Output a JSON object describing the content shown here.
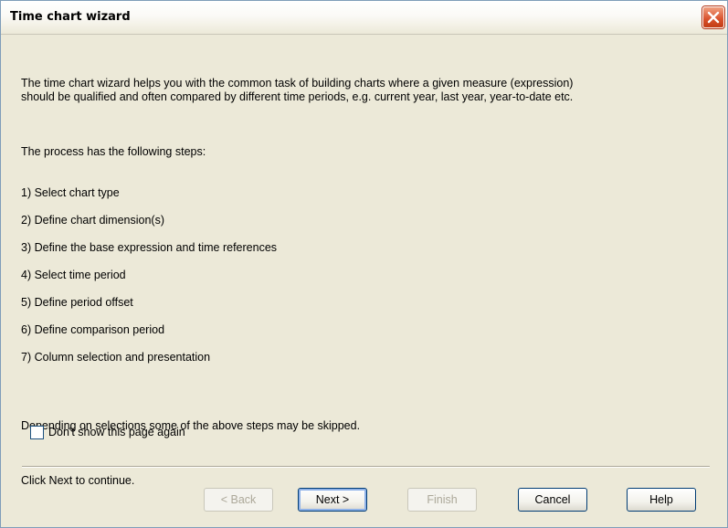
{
  "window": {
    "title": "Time chart wizard"
  },
  "intro": {
    "paragraph1": "The time chart wizard helps you with the common task of building charts where a given measure (expression)\nshould be qualified and often compared by different time periods, e.g. current year, last year, year-to-date etc.",
    "steps_heading": "The process has the following steps:",
    "steps": [
      "1) Select chart type",
      "2) Define chart dimension(s)",
      "3) Define the base expression and time references",
      "4) Select time period",
      "5) Define period offset",
      "6) Define comparison period",
      "7) Column selection and presentation"
    ],
    "note": "Depending on selections some of the above steps may be skipped.",
    "instruction": "Click Next to continue."
  },
  "options": {
    "dont_show_label": "Don't show this page again",
    "dont_show_checked": false
  },
  "buttons": {
    "back": "< Back",
    "next": "Next >",
    "finish": "Finish",
    "cancel": "Cancel",
    "help": "Help"
  },
  "icons": {
    "close": "close-icon"
  }
}
